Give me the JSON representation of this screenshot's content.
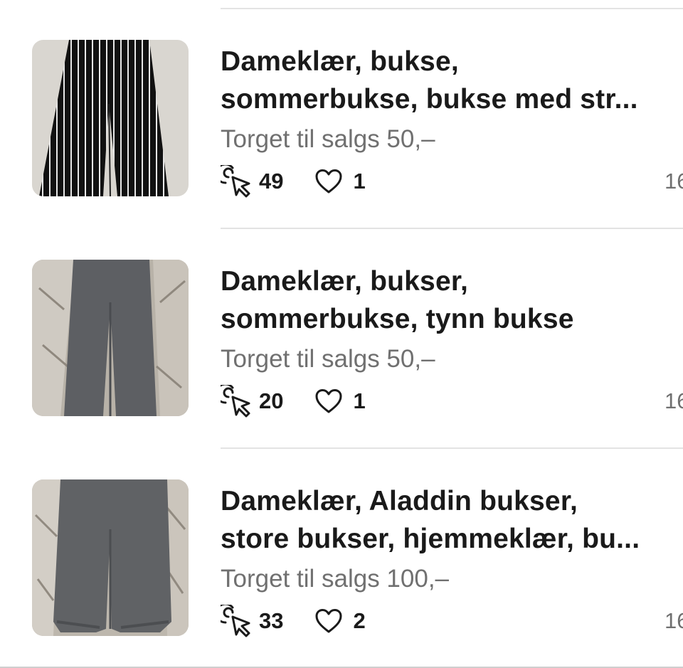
{
  "listings": [
    {
      "title_line1": "Dameklær, bukse,",
      "title_line2": "sommerbukse, bukse med str...",
      "price": "Torget til salgs 50,–",
      "clicks": "49",
      "likes": "1",
      "date_fragment": "16",
      "image": "striped-trousers-photo"
    },
    {
      "title_line1": "Dameklær, bukser,",
      "title_line2": "sommerbukse, tynn bukse",
      "price": "Torget til salgs 50,–",
      "clicks": "20",
      "likes": "1",
      "date_fragment": "16",
      "image": "grey-trousers-photo"
    },
    {
      "title_line1": "Dameklær, Aladdin bukser,",
      "title_line2": "store bukser, hjemmeklær, bu...",
      "price": "Torget til salgs 100,–",
      "clicks": "33",
      "likes": "2",
      "date_fragment": "16",
      "image": "aladdin-trousers-photo"
    }
  ],
  "icons": {
    "clicks": "cursor-click-icon",
    "likes": "heart-icon"
  },
  "colors": {
    "title": "#1a1a1a",
    "secondary": "#707070",
    "divider": "#e3e3e3"
  }
}
